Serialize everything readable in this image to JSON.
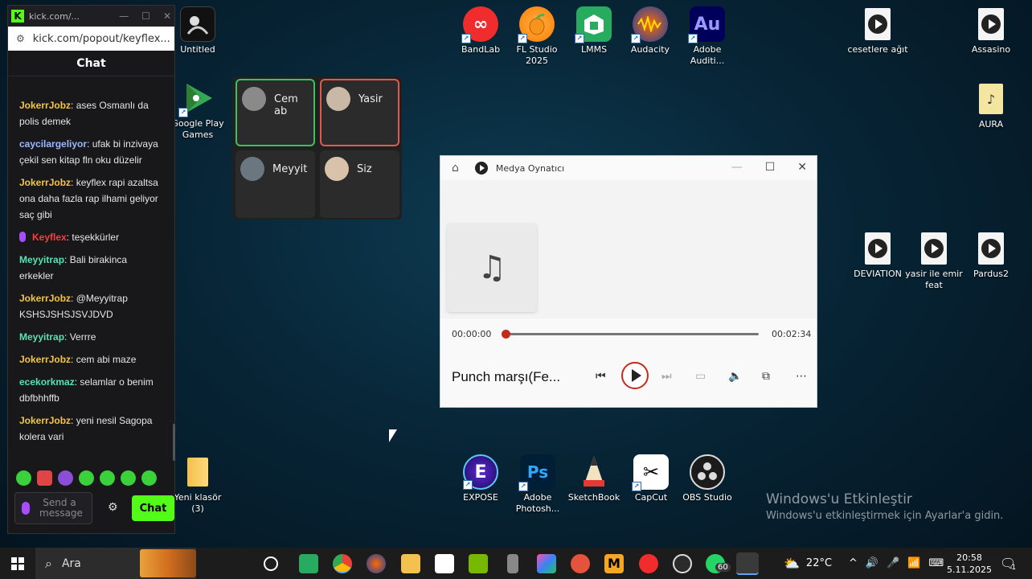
{
  "desktop": {
    "icons": [
      {
        "label": "Untitled"
      },
      {
        "label": "Google Play Games"
      },
      {
        "label": "BandLab"
      },
      {
        "label": "FL Studio 2025"
      },
      {
        "label": "LMMS"
      },
      {
        "label": "Audacity"
      },
      {
        "label": "Adobe Auditi..."
      },
      {
        "label": "cesetlere ağıt"
      },
      {
        "label": "Assasino"
      },
      {
        "label": "AURA"
      },
      {
        "label": "DEVIATION"
      },
      {
        "label": "yasir ile emir feat"
      },
      {
        "label": "Pardus2"
      },
      {
        "label": "Yeni klasör (3)"
      },
      {
        "label": "EXPOSE"
      },
      {
        "label": "Adobe Photosh..."
      },
      {
        "label": "SketchBook"
      },
      {
        "label": "CapCut"
      },
      {
        "label": "OBS Studio"
      }
    ],
    "watermark_title": "Windows'u Etkinleştir",
    "watermark_sub": "Windows'u etkinleştirmek için Ayarlar'a gidin."
  },
  "kick": {
    "window_title": "kick.com/...",
    "url": "kick.com/popout/keyflex...",
    "header": "Chat",
    "messages": [
      {
        "user": "JokerrJobz",
        "color": "#f5c542",
        "text": "ases Osmanlı da polis demek"
      },
      {
        "user": "caycilargeliyor",
        "color": "#9ab8ff",
        "text": "ufak bi inzivaya çekil sen kitap fln oku düzelir"
      },
      {
        "user": "JokerrJobz",
        "color": "#f5c542",
        "text": "keyflex rapi azaltsa ona daha fazla rap ilhami geliyor saç gibi"
      },
      {
        "user": "Keyflex",
        "color": "#ff3b3b",
        "text": "teşekkürler"
      },
      {
        "user": "Meyyitrap",
        "color": "#57e3b0",
        "text": "Bali birakinca erkekler"
      },
      {
        "user": "JokerrJobz",
        "color": "#f5c542",
        "text": "@Meyyitrap KSHSJSHSJSVJDVD"
      },
      {
        "user": "Meyyitrap",
        "color": "#57e3b0",
        "text": "Verrre"
      },
      {
        "user": "JokerrJobz",
        "color": "#f5c542",
        "text": "cem abi maze"
      },
      {
        "user": "ecekorkmaz",
        "color": "#57e3b0",
        "text": "selamlar o benim dbfbhhffb"
      },
      {
        "user": "JokerrJobz",
        "color": "#f5c542",
        "text": "yeni nesil Sagopa kolera vari"
      }
    ],
    "input_placeholder": "Send a message",
    "send_label": "Chat"
  },
  "call": {
    "participants": [
      {
        "name": "Cem ab"
      },
      {
        "name": "Yasir"
      },
      {
        "name": "Meyyit"
      },
      {
        "name": "Siz"
      }
    ]
  },
  "media_player": {
    "title": "Medya Oynatıcı",
    "time_current": "00:00:00",
    "time_total": "00:02:34",
    "progress": 0,
    "song": "Punch marşı(Fe..."
  },
  "taskbar": {
    "search_label": "Ara",
    "weather": "22°C",
    "time": "20:58",
    "date": "5.11.2025",
    "whatsapp_badge": "60",
    "notification_count": "1"
  }
}
